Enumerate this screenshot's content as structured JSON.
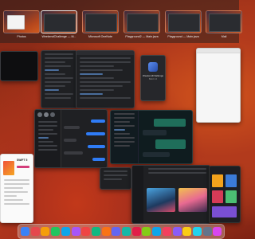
{
  "spaces": [
    {
      "label": "Photos",
      "active": false
    },
    {
      "label": "WeekendChallenge — M...",
      "active": true
    },
    {
      "label": "Microsoft OneNote",
      "active": false
    },
    {
      "label": "Playground2 — Main.java",
      "active": false
    },
    {
      "label": "Playground — Main.java",
      "active": false
    },
    {
      "label": "Mail",
      "active": false
    }
  ],
  "windows": {
    "center_app_title": "WeekendChallenge",
    "center_app_subtitle": "Build 1.0",
    "article_title": "SWIFT 5"
  },
  "dock": {
    "icon_colors": [
      "#3b82f6",
      "#e5484d",
      "#f59e0b",
      "#22c55e",
      "#0ea5e9",
      "#a855f7",
      "#ef4444",
      "#10b981",
      "#f97316",
      "#6366f1",
      "#14b8a6",
      "#e11d48",
      "#84cc16",
      "#0ea5e9",
      "#f43f5e",
      "#8b5cf6",
      "#facc15",
      "#22d3ee",
      "#64748b",
      "#d946ef"
    ]
  }
}
